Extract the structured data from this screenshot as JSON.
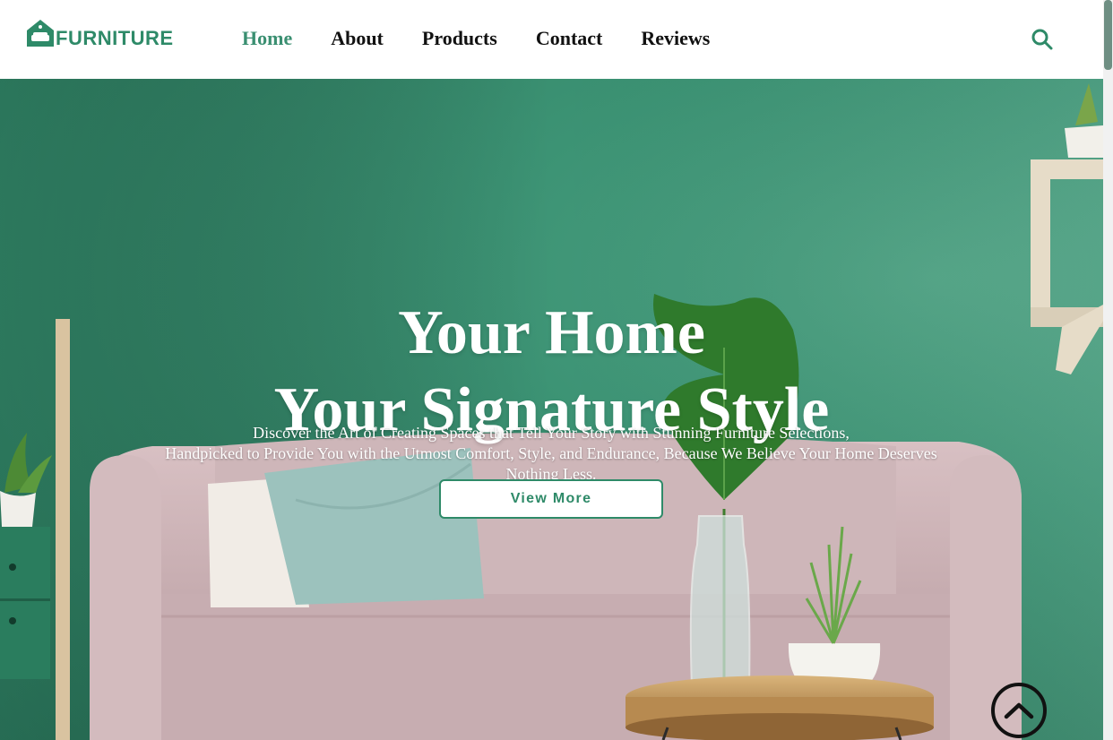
{
  "brand": {
    "name": "FURNITURE",
    "color": "#2e8a68"
  },
  "nav": {
    "items": [
      {
        "label": "Home",
        "active": true
      },
      {
        "label": "About",
        "active": false
      },
      {
        "label": "Products",
        "active": false
      },
      {
        "label": "Contact",
        "active": false
      },
      {
        "label": "Reviews",
        "active": false
      }
    ]
  },
  "icons": {
    "search": "search-icon",
    "scroll_top": "chevron-up-icon",
    "logo": "house-sofa-icon"
  },
  "hero": {
    "title_line1": "Your Home",
    "title_line2": "Your Signature Style",
    "description_line1": "Discover the Art of Creating Spaces that Tell Your Story with Stunning Furniture Selections,",
    "description_line2": "Handpicked to Provide You with the Utmost Comfort, Style, and Endurance, Because We Believe Your Home Deserves",
    "description_line3": "Nothing Less.",
    "cta_label": "View More"
  },
  "colors": {
    "accent": "#3a8f71",
    "hero_wall": "#3c9374",
    "text_dark": "#111111"
  }
}
